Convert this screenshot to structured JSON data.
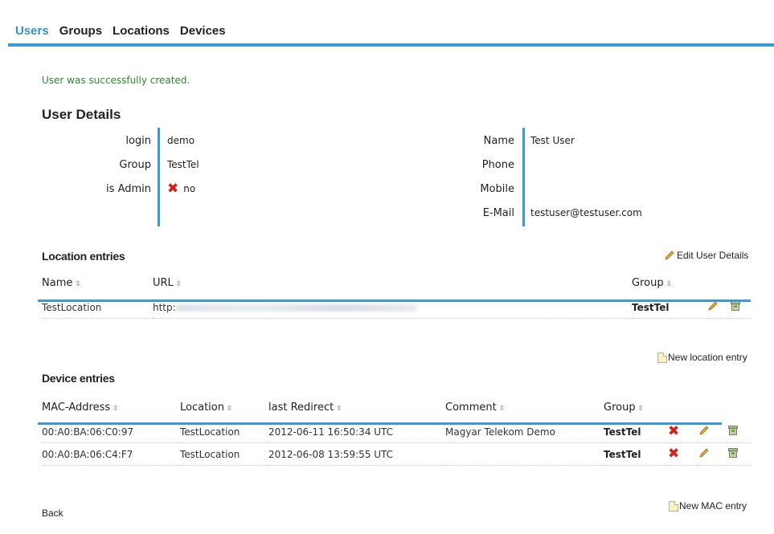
{
  "nav": {
    "items": [
      "Users",
      "Groups",
      "Locations",
      "Devices"
    ]
  },
  "flash": "User was successfully created.",
  "title": "User Details",
  "details": {
    "left": [
      {
        "label": "login",
        "value": "demo"
      },
      {
        "label": "Group",
        "value": "TestTel"
      },
      {
        "label": "is Admin",
        "value": "no"
      }
    ],
    "right": [
      {
        "label": "Name",
        "value": "Test User"
      },
      {
        "label": "Phone",
        "value": ""
      },
      {
        "label": "Mobile",
        "value": ""
      },
      {
        "label": "E-Mail",
        "value": "testuser@testuser.com"
      }
    ]
  },
  "locations": {
    "title": "Location entries",
    "edit_label": "Edit User Details",
    "columns": {
      "name": "Name",
      "url": "URL",
      "group": "Group"
    },
    "rows": [
      {
        "name": "TestLocation",
        "url_prefix": "http:",
        "group": "TestTel"
      }
    ],
    "new_label": "New location entry"
  },
  "devices": {
    "title": "Device entries",
    "columns": {
      "mac": "MAC-Address",
      "location": "Location",
      "redirect": "last Redirect",
      "comment": "Comment",
      "group": "Group"
    },
    "rows": [
      {
        "mac": "00:A0:BA:06:C0:97",
        "location": "TestLocation",
        "redirect": "2012-06-11 16:50:34 UTC",
        "comment": "Magyar Telekom Demo",
        "group": "TestTel"
      },
      {
        "mac": "00:A0:BA:06:C4:F7",
        "location": "TestLocation",
        "redirect": "2012-06-08 13:59:55 UTC",
        "comment": "",
        "group": "TestTel"
      }
    ],
    "new_label": "New MAC entry"
  },
  "back_label": "Back",
  "sort_glyph": "⇳",
  "colors": {
    "accent": "#3a9ad9",
    "success": "#2b8a2b",
    "delete": "#d3201c"
  },
  "icons": {
    "delete": "x-icon",
    "edit": "pencil-icon",
    "remove": "trash-icon",
    "new": "document-icon",
    "admin_no": "x-icon"
  }
}
